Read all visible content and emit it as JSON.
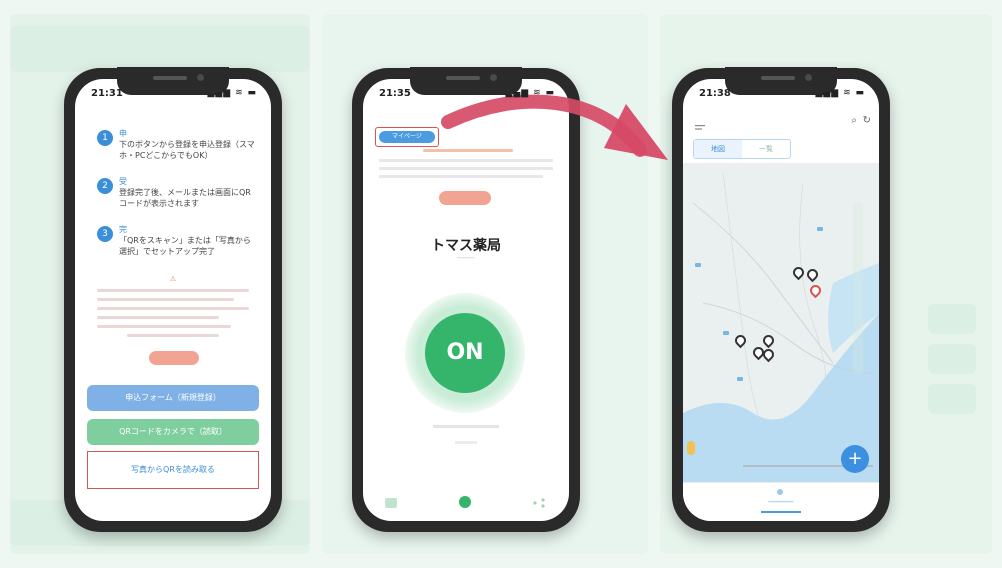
{
  "phone1": {
    "time": "21:31",
    "status_icons": "▂▄▆ ≋ ▬",
    "steps": [
      {
        "num": "1",
        "title": "申",
        "desc": "下のボタンから登録を申込登録（スマホ・PCどこからでもOK）"
      },
      {
        "num": "2",
        "title": "受",
        "desc": "登録完了後、メールまたは画面にQRコードが表示されます"
      },
      {
        "num": "3",
        "title": "完",
        "desc": "「QRをスキャン」または「写真から選択」でセットアップ完了"
      }
    ],
    "buttons": {
      "form_label": "申込フォーム（新規登録）",
      "scan_label": "QRコードをカメラで（読取）",
      "photo_label": "写真からQRを読み取る"
    }
  },
  "phone2": {
    "time": "21:35",
    "status_icons": "▂▄▆ ≋ ▬",
    "tag_label": "マイページ",
    "store_name": "トマス薬局",
    "on_label": "ON"
  },
  "phone3": {
    "time": "21:38",
    "status_icons": "▂▄▆ ≋ ▬",
    "tabs": [
      "地図",
      "一覧"
    ],
    "fab_label": "+"
  },
  "colors": {
    "accent_blue": "#3b8fd9",
    "on_green": "#35b46c",
    "highlight_red": "#d9534f",
    "arrow_red": "#d64a66"
  }
}
